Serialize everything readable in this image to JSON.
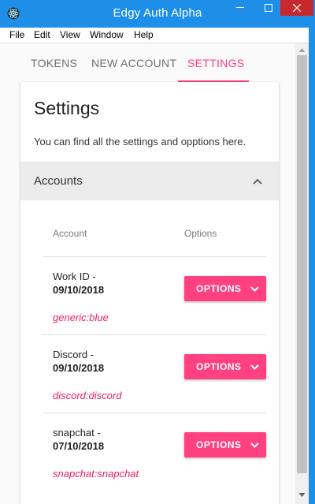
{
  "window": {
    "title": "Edgy Auth Alpha",
    "controls": {
      "minimize": "minimize-icon",
      "maximize": "maximize-icon",
      "close": "close-icon"
    }
  },
  "menu": [
    "File",
    "Edit",
    "View",
    "Window",
    "Help"
  ],
  "tabs": [
    {
      "label": "TOKENS",
      "active": false
    },
    {
      "label": "NEW ACCOUNT",
      "active": false
    },
    {
      "label": "SETTINGS",
      "active": true
    }
  ],
  "settings": {
    "title": "Settings",
    "subtitle": "You can find all the settings and opptions here.",
    "accounts_section": {
      "title": "Accounts",
      "expanded": true,
      "columns": [
        "Account",
        "Options"
      ],
      "rows": [
        {
          "name": "Work ID -",
          "date": "09/10/2018",
          "type": "generic:blue",
          "button": "OPTIONS"
        },
        {
          "name": "Discord -",
          "date": "09/10/2018",
          "type": "discord:discord",
          "button": "OPTIONS"
        },
        {
          "name": "snapchat -",
          "date": "07/10/2018",
          "type": "snapchat:snapchat",
          "button": "OPTIONS"
        }
      ]
    }
  },
  "colors": {
    "titlebar": "#1e8fe8",
    "accent": "#ff4081",
    "close": "#c7282c",
    "type_text": "#e91e63"
  }
}
